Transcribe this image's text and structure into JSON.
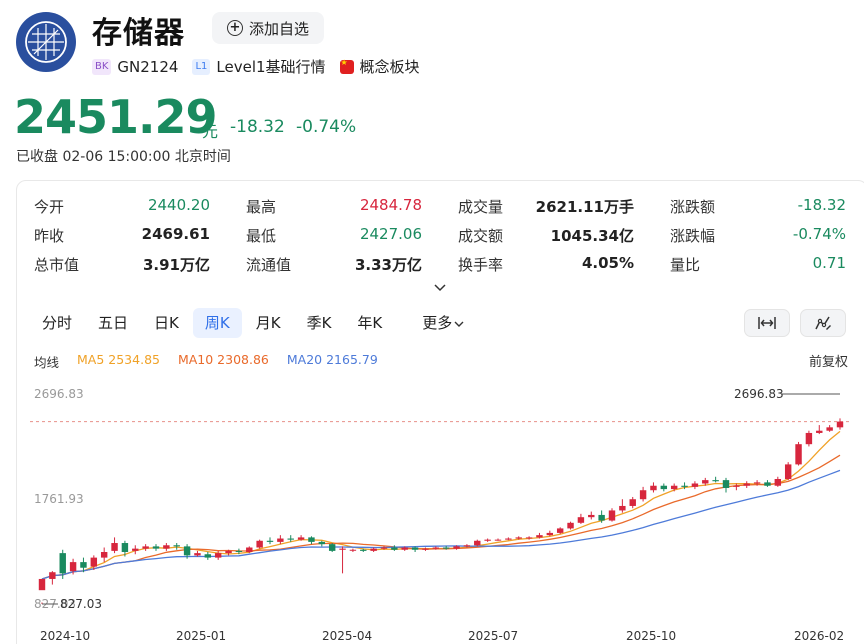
{
  "header": {
    "title": "存储器",
    "watch_label": "添加自选",
    "tags": [
      {
        "badge": "BK",
        "text": "GN2124"
      },
      {
        "badge": "L1",
        "text": "Level1基础行情"
      },
      {
        "badge": "flag",
        "text": "概念板块"
      }
    ]
  },
  "quote": {
    "price": "2451.29",
    "unit": "元",
    "change": "-18.32",
    "change_pct": "-0.74%",
    "status": "已收盘 02-06 15:00:00 北京时间"
  },
  "stats": [
    [
      {
        "label": "今开",
        "value": "2440.20",
        "tone": "green"
      },
      {
        "label": "最高",
        "value": "2484.78",
        "tone": "red"
      },
      {
        "label": "成交量",
        "value": "2621.11万手",
        "tone": "black"
      },
      {
        "label": "涨跌额",
        "value": "-18.32",
        "tone": "green"
      }
    ],
    [
      {
        "label": "昨收",
        "value": "2469.61",
        "tone": "black"
      },
      {
        "label": "最低",
        "value": "2427.06",
        "tone": "green"
      },
      {
        "label": "成交额",
        "value": "1045.34亿",
        "tone": "black"
      },
      {
        "label": "涨跌幅",
        "value": "-0.74%",
        "tone": "green"
      }
    ],
    [
      {
        "label": "总市值",
        "value": "3.91万亿",
        "tone": "black"
      },
      {
        "label": "流通值",
        "value": "3.33万亿",
        "tone": "black"
      },
      {
        "label": "换手率",
        "value": "4.05%",
        "tone": "black"
      },
      {
        "label": "量比",
        "value": "0.71",
        "tone": "green"
      }
    ]
  ],
  "tabs": [
    "分时",
    "五日",
    "日K",
    "周K",
    "月K",
    "季K",
    "年K"
  ],
  "active_tab": "周K",
  "more_label": "更多",
  "ma": {
    "label": "均线",
    "ma5": "MA5 2534.85",
    "ma10": "MA10 2308.86",
    "ma20": "MA20 2165.79"
  },
  "adjust_label": "前复权",
  "colors": {
    "up": "#d7263d",
    "down": "#1a8a5f",
    "ma5": "#f0a228",
    "ma10": "#e96a2b",
    "ma20": "#4e7bd9",
    "accent": "#2f6fe8"
  },
  "icons": [
    "plus-circle-icon",
    "chevron-down-icon",
    "fit-width-icon",
    "draw-tool-icon"
  ],
  "chart_data": {
    "type": "candlestick",
    "y_ticks": [
      "2696.83",
      "1761.93",
      "827.03"
    ],
    "ylim": [
      827.03,
      2696.83
    ],
    "x_ticks": [
      "2024-10",
      "2025-01",
      "2025-04",
      "2025-07",
      "2025-10",
      "2026-02"
    ],
    "max_label": "2696.83",
    "min_label": "827.03",
    "last_close": 2451.29,
    "candles": [
      [
        950,
        1050,
        840,
        827.03
      ],
      [
        1050,
        1110,
        1000,
        1120
      ],
      [
        1280,
        1100,
        1050,
        1310
      ],
      [
        1120,
        1200,
        1090,
        1230
      ],
      [
        1200,
        1150,
        1110,
        1240
      ],
      [
        1160,
        1240,
        1130,
        1260
      ],
      [
        1240,
        1290,
        1200,
        1330
      ],
      [
        1300,
        1370,
        1280,
        1420
      ],
      [
        1370,
        1290,
        1250,
        1390
      ],
      [
        1300,
        1320,
        1270,
        1350
      ],
      [
        1320,
        1340,
        1300,
        1360
      ],
      [
        1340,
        1320,
        1300,
        1360
      ],
      [
        1320,
        1350,
        1300,
        1370
      ],
      [
        1350,
        1340,
        1310,
        1370
      ],
      [
        1340,
        1260,
        1230,
        1360
      ],
      [
        1260,
        1280,
        1250,
        1300
      ],
      [
        1270,
        1240,
        1220,
        1290
      ],
      [
        1240,
        1280,
        1220,
        1300
      ],
      [
        1280,
        1300,
        1260,
        1310
      ],
      [
        1300,
        1290,
        1270,
        1320
      ],
      [
        1290,
        1330,
        1280,
        1340
      ],
      [
        1330,
        1390,
        1320,
        1400
      ],
      [
        1390,
        1380,
        1360,
        1420
      ],
      [
        1380,
        1410,
        1360,
        1440
      ],
      [
        1410,
        1400,
        1380,
        1440
      ],
      [
        1400,
        1420,
        1390,
        1440
      ],
      [
        1420,
        1380,
        1360,
        1430
      ],
      [
        1380,
        1360,
        1340,
        1390
      ],
      [
        1360,
        1300,
        1290,
        1370
      ],
      [
        1310,
        1320,
        1100,
        1340
      ],
      [
        1310,
        1310,
        1290,
        1320
      ],
      [
        1310,
        1300,
        1290,
        1320
      ],
      [
        1300,
        1320,
        1290,
        1330
      ],
      [
        1320,
        1330,
        1310,
        1340
      ],
      [
        1330,
        1310,
        1300,
        1350
      ],
      [
        1310,
        1330,
        1300,
        1340
      ],
      [
        1330,
        1310,
        1290,
        1340
      ],
      [
        1310,
        1320,
        1300,
        1330
      ],
      [
        1320,
        1330,
        1310,
        1340
      ],
      [
        1330,
        1320,
        1310,
        1345
      ],
      [
        1320,
        1340,
        1310,
        1350
      ],
      [
        1340,
        1350,
        1330,
        1360
      ],
      [
        1350,
        1390,
        1340,
        1400
      ],
      [
        1390,
        1400,
        1380,
        1410
      ],
      [
        1400,
        1400,
        1390,
        1410
      ],
      [
        1400,
        1410,
        1395,
        1420
      ],
      [
        1410,
        1420,
        1400,
        1430
      ],
      [
        1420,
        1420,
        1400,
        1430
      ],
      [
        1420,
        1440,
        1410,
        1460
      ],
      [
        1440,
        1460,
        1430,
        1480
      ],
      [
        1460,
        1500,
        1450,
        1510
      ],
      [
        1500,
        1550,
        1490,
        1560
      ],
      [
        1550,
        1600,
        1540,
        1630
      ],
      [
        1600,
        1620,
        1580,
        1650
      ],
      [
        1620,
        1570,
        1550,
        1660
      ],
      [
        1570,
        1660,
        1560,
        1680
      ],
      [
        1660,
        1700,
        1640,
        1760
      ],
      [
        1700,
        1760,
        1680,
        1780
      ],
      [
        1760,
        1840,
        1740,
        1870
      ],
      [
        1840,
        1880,
        1820,
        1910
      ],
      [
        1880,
        1850,
        1830,
        1900
      ],
      [
        1850,
        1880,
        1830,
        1900
      ],
      [
        1880,
        1870,
        1850,
        1910
      ],
      [
        1870,
        1900,
        1850,
        1920
      ],
      [
        1900,
        1930,
        1880,
        1950
      ],
      [
        1930,
        1920,
        1910,
        1960
      ],
      [
        1930,
        1860,
        1820,
        1950
      ],
      [
        1870,
        1880,
        1840,
        1900
      ],
      [
        1880,
        1900,
        1860,
        1920
      ],
      [
        1900,
        1910,
        1880,
        1930
      ],
      [
        1910,
        1880,
        1870,
        1930
      ],
      [
        1880,
        1940,
        1870,
        1960
      ],
      [
        1940,
        2070,
        1930,
        2090
      ],
      [
        2070,
        2250,
        2060,
        2270
      ],
      [
        2250,
        2350,
        2230,
        2370
      ],
      [
        2350,
        2370,
        2340,
        2420
      ],
      [
        2370,
        2400,
        2360,
        2420
      ],
      [
        2400,
        2451.29,
        2380,
        2480
      ]
    ]
  }
}
